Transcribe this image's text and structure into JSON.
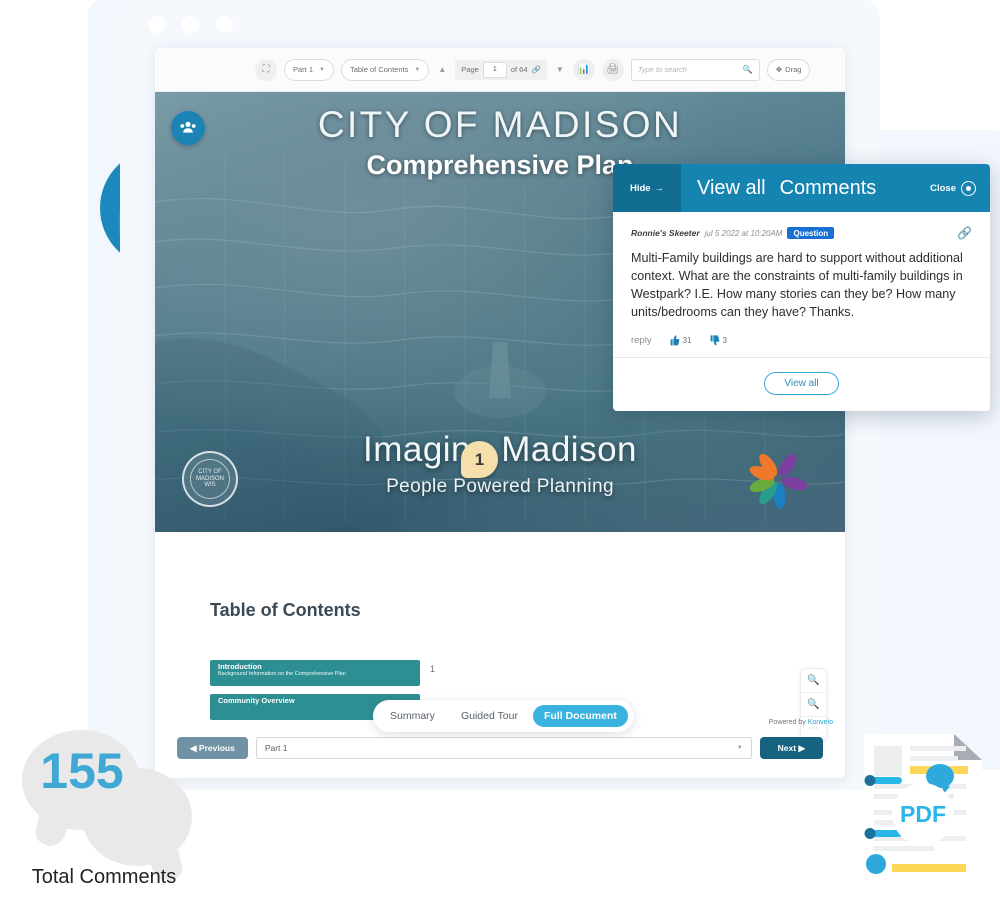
{
  "window": {
    "dots": [
      "dot-1",
      "dot-2",
      "dot-3"
    ]
  },
  "toolbar": {
    "fullscreen_icon": "expand-icon",
    "part_select": "Part 1",
    "section_select": "Table of Contents",
    "prev_page_arrow": "▲",
    "next_page_arrow": "▼",
    "page_label": "Page",
    "page_value": "1",
    "page_total": "of 64",
    "page_link_icon": "link-icon",
    "chart_icon": "chart-icon",
    "print_icon": "print-icon",
    "search_placeholder": "Type to search",
    "search_icon": "search-icon",
    "drag_label": "Drag",
    "drag_icon": "move-icon"
  },
  "people_button": {
    "icon": "people-icon"
  },
  "cover": {
    "title": "CITY OF MADISON",
    "subtitle": "Comprehensive Plan",
    "brand": "Imagine Madison",
    "tagline": "People Powered Planning",
    "seal_text": "CITY OF MADISON WIS",
    "logo": "pinwheel-logo",
    "marker_number": "1"
  },
  "toc": {
    "heading": "Table of Contents",
    "rows": [
      {
        "title": "Introduction",
        "description": "Background Information on the Comprehensive Plan",
        "page": "1"
      },
      {
        "title": "Community Overview",
        "description": "",
        "page": ""
      }
    ]
  },
  "zoom_controls": {
    "zoom_in": "zoom-in-icon",
    "zoom_out": "zoom-out-icon",
    "fit": "fit-icon"
  },
  "powered_by": {
    "prefix": "Powered by ",
    "brand": "Konveio"
  },
  "mode_tabs": [
    {
      "label": "Summary",
      "active": false
    },
    {
      "label": "Guided Tour",
      "active": false
    },
    {
      "label": "Full Document",
      "active": true
    }
  ],
  "bottom_nav": {
    "previous": "◀ Previous",
    "part_value": "Part 1",
    "next": "Next ▶"
  },
  "comments_panel": {
    "hide_label": "Hide",
    "hide_icon": "arrow-right-icon",
    "view_all_tab": "View all",
    "comments_tab": "Comments",
    "close_label": "Close",
    "close_icon": "close-circle-icon",
    "comment": {
      "author": "Ronnie's Skeeter",
      "date": "jul 5 2022 at 10:20AM",
      "badge": "Question",
      "link_icon": "link-icon",
      "text": "Multi-Family buildings are hard to support without additional context. What are the constraints of multi-family buildings in Westpark? I.E. How many stories can they be? How many units/bedrooms can they have? Thanks.",
      "reply_label": "reply",
      "thumbs_up_icon": "thumbs-up-icon",
      "thumbs_up_count": "31",
      "thumbs_down_icon": "thumbs-down-icon",
      "thumbs_down_count": "3"
    },
    "view_all_button": "View all"
  },
  "stat": {
    "count": "155",
    "label": "Total Comments"
  },
  "pdf_graphic": {
    "label": "PDF"
  },
  "colors": {
    "accent_blue": "#1684b0",
    "light_blue": "#3fa8d4",
    "teal": "#2d8f92",
    "dark_teal": "#17627f",
    "badge_blue": "#1a6fd4",
    "marker_cream": "#f6dfaa",
    "yellow": "#fcd757"
  }
}
